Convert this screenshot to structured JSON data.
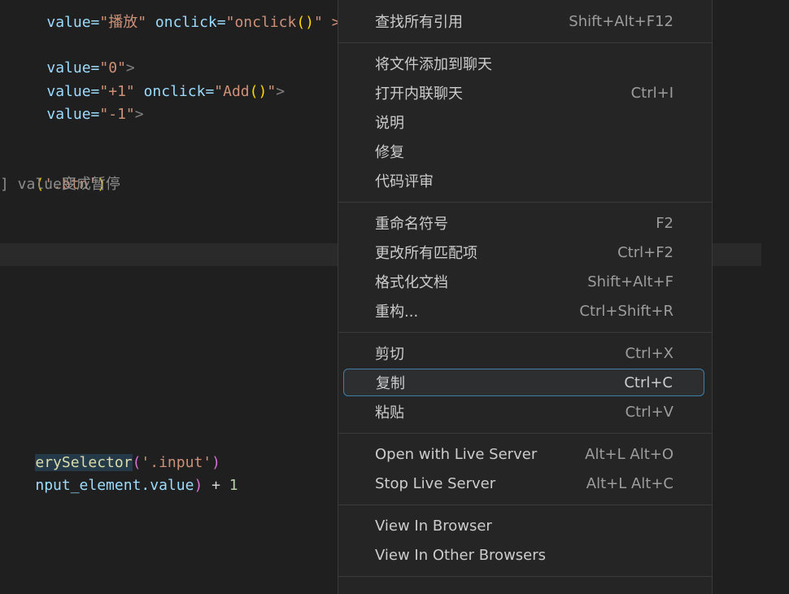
{
  "editor": {
    "line0": {
      "a": "value=",
      "b": "\"播放\"",
      "c": " onclick=",
      "d": "\"onclick",
      "e": "()",
      "f": "\" >"
    },
    "line1": {
      "a": "value=",
      "b": "\"0\"",
      "c": ">"
    },
    "line2": {
      "a": "value=",
      "b": "\"+1\"",
      "c": " onclick=",
      "d": "\"Add",
      "e": "()",
      "f": "\"",
      "g": ">"
    },
    "line3": {
      "a": "value=",
      "b": "\"-1\"",
      "c": ">"
    },
    "line4": {
      "a": "(",
      "b": "'.btn'",
      "c": ")"
    },
    "line5": {
      "text": "] value变成暂停"
    },
    "line6": {
      "a": "erySelector",
      "b": "(",
      "c": "'.input'",
      "d": ")"
    },
    "line7": {
      "a": "nput_element.value",
      "b": ")",
      "c": " + ",
      "d": "1"
    }
  },
  "menu": {
    "items": [
      {
        "label": "查找所有引用",
        "shortcut": "Shift+Alt+F12"
      },
      {
        "label": "将文件添加到聊天",
        "shortcut": ""
      },
      {
        "label": "打开内联聊天",
        "shortcut": "Ctrl+I"
      },
      {
        "label": "说明",
        "shortcut": ""
      },
      {
        "label": "修复",
        "shortcut": ""
      },
      {
        "label": "代码评审",
        "shortcut": ""
      },
      {
        "label": "重命名符号",
        "shortcut": "F2"
      },
      {
        "label": "更改所有匹配项",
        "shortcut": "Ctrl+F2"
      },
      {
        "label": "格式化文档",
        "shortcut": "Shift+Alt+F"
      },
      {
        "label": "重构...",
        "shortcut": "Ctrl+Shift+R"
      },
      {
        "label": "剪切",
        "shortcut": "Ctrl+X"
      },
      {
        "label": "复制",
        "shortcut": "Ctrl+C"
      },
      {
        "label": "粘贴",
        "shortcut": "Ctrl+V"
      },
      {
        "label": "Open with Live Server",
        "shortcut": "Alt+L Alt+O"
      },
      {
        "label": "Stop Live Server",
        "shortcut": "Alt+L Alt+C"
      },
      {
        "label": "View In Browser",
        "shortcut": ""
      },
      {
        "label": "View In Other Browsers",
        "shortcut": ""
      }
    ]
  }
}
